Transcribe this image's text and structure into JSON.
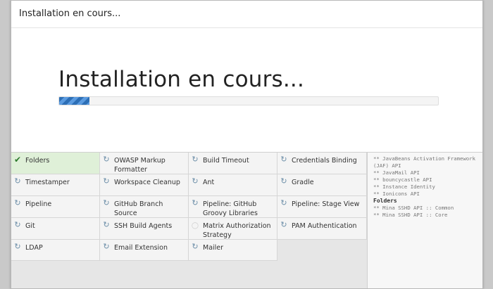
{
  "window": {
    "title": "Installation en cours..."
  },
  "hero": {
    "heading": "Installation en cours...",
    "progress": 0.08
  },
  "plugins": [
    {
      "name": "Folders",
      "status": "success"
    },
    {
      "name": "OWASP Markup Formatter",
      "status": "installing"
    },
    {
      "name": "Build Timeout",
      "status": "installing"
    },
    {
      "name": "Credentials Binding",
      "status": "installing"
    },
    {
      "name": "Timestamper",
      "status": "installing"
    },
    {
      "name": "Workspace Cleanup",
      "status": "installing"
    },
    {
      "name": "Ant",
      "status": "installing"
    },
    {
      "name": "Gradle",
      "status": "installing"
    },
    {
      "name": "Pipeline",
      "status": "installing"
    },
    {
      "name": "GitHub Branch Source",
      "status": "installing"
    },
    {
      "name": "Pipeline: GitHub Groovy Libraries",
      "status": "installing"
    },
    {
      "name": "Pipeline: Stage View",
      "status": "installing"
    },
    {
      "name": "Git",
      "status": "installing"
    },
    {
      "name": "SSH Build Agents",
      "status": "installing"
    },
    {
      "name": "Matrix Authorization Strategy",
      "status": "pending"
    },
    {
      "name": "PAM Authentication",
      "status": "installing"
    },
    {
      "name": "LDAP",
      "status": "installing"
    },
    {
      "name": "Email Extension",
      "status": "installing"
    },
    {
      "name": "Mailer",
      "status": "installing"
    }
  ],
  "log": [
    {
      "text": "** JavaBeans Activation Framework",
      "head": false
    },
    {
      "text": "(JAF) API",
      "head": false
    },
    {
      "text": "** JavaMail API",
      "head": false
    },
    {
      "text": "** bouncycastle API",
      "head": false
    },
    {
      "text": "** Instance Identity",
      "head": false
    },
    {
      "text": "** Ionicons API",
      "head": false
    },
    {
      "text": "Folders",
      "head": true
    },
    {
      "text": "** Mina SSHD API :: Common",
      "head": false
    },
    {
      "text": "** Mina SSHD API :: Core",
      "head": false
    }
  ],
  "icons": {
    "success": "check-icon",
    "installing": "refresh-icon",
    "pending": "pending-circle-icon"
  },
  "colors": {
    "success_bg": "#dff0d8",
    "progress": "#2d6fb6"
  }
}
